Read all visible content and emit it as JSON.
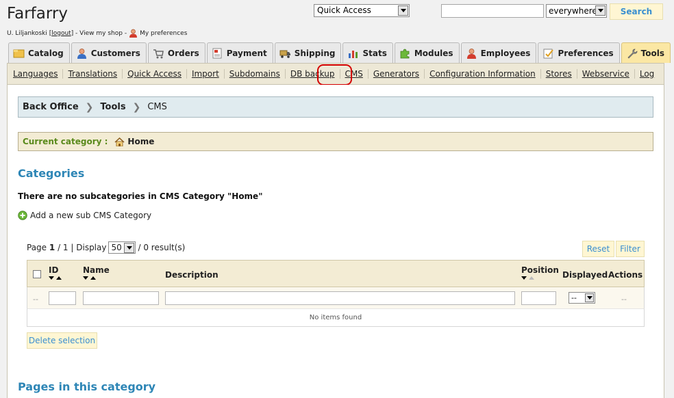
{
  "header": {
    "shop_name": "Farfarry",
    "user_prefix": "U. Liljankoski [",
    "logout_label": "logout",
    "user_suffix": "] - View my shop -",
    "preferences_label": "My preferences",
    "quick_access_value": "Quick Access",
    "search_value": "",
    "search_scope_value": "everywhere",
    "search_button_label": "Search"
  },
  "tabs": [
    {
      "label": "Catalog",
      "icon": "catalog-icon",
      "active": false
    },
    {
      "label": "Customers",
      "icon": "customers-icon",
      "active": false
    },
    {
      "label": "Orders",
      "icon": "cart-icon",
      "active": false
    },
    {
      "label": "Payment",
      "icon": "payment-icon",
      "active": false
    },
    {
      "label": "Shipping",
      "icon": "truck-icon",
      "active": false
    },
    {
      "label": "Stats",
      "icon": "chart-icon",
      "active": false
    },
    {
      "label": "Modules",
      "icon": "puzzle-icon",
      "active": false
    },
    {
      "label": "Employees",
      "icon": "employee-icon",
      "active": false
    },
    {
      "label": "Preferences",
      "icon": "preferences-icon",
      "active": false
    },
    {
      "label": "Tools",
      "icon": "wrench-icon",
      "active": true
    }
  ],
  "subnav": [
    "Languages",
    "Translations",
    "Quick Access",
    "Import",
    "Subdomains",
    "DB backup",
    "CMS",
    "Generators",
    "Configuration Information",
    "Stores",
    "Webservice",
    "Log"
  ],
  "breadcrumb": [
    "Back Office",
    "Tools",
    "CMS"
  ],
  "current_category": {
    "label": "Current category :",
    "value": "Home"
  },
  "categories": {
    "heading": "Categories",
    "no_subcategories": "There are no subcategories in CMS Category \"Home\"",
    "add_label": "Add a new sub CMS Category"
  },
  "pager": {
    "page_prefix": "Page",
    "page_current": "1",
    "page_total": "/ 1 | Display",
    "per_page": "50",
    "results": "/ 0 result(s)"
  },
  "buttons": {
    "reset": "Reset",
    "filter": "Filter",
    "delete_selection": "Delete selection"
  },
  "table": {
    "columns": {
      "id": "ID",
      "name": "Name",
      "description": "Description",
      "position": "Position",
      "displayed": "Displayed",
      "actions": "Actions"
    },
    "filter_dash": "--",
    "displayed_filter_value": "--",
    "empty_message": "No items found"
  },
  "pages": {
    "heading": "Pages in this category"
  }
}
